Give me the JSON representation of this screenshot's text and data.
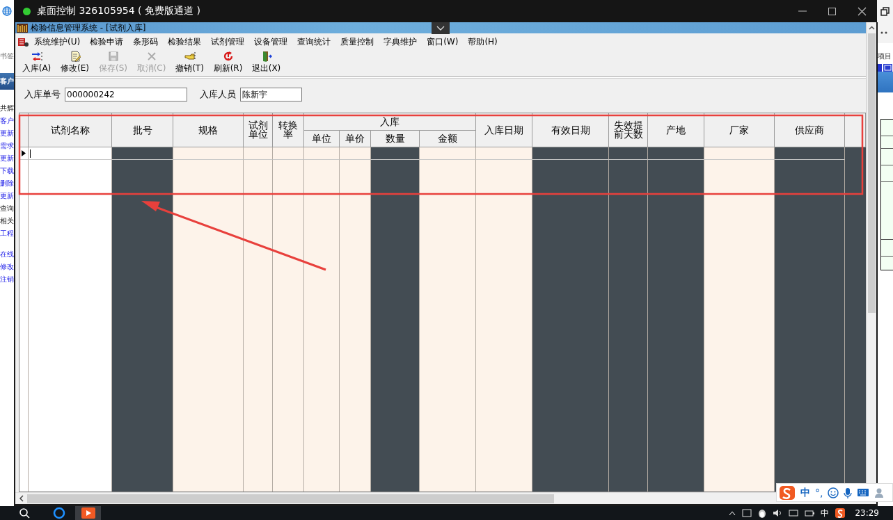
{
  "remote_window": {
    "title": "桌面控制 326105954 ( 免费版通道 )"
  },
  "background_left": {
    "bookmarks": "书签",
    "header": "客户",
    "links": [
      {
        "text": "共辉",
        "link": false
      },
      {
        "text": "客户",
        "link": true
      },
      {
        "text": "更新",
        "link": true
      },
      {
        "text": "需求",
        "link": true
      },
      {
        "text": "更新",
        "link": true
      },
      {
        "text": "下载",
        "link": true
      },
      {
        "text": "删除",
        "link": true
      },
      {
        "text": "更新",
        "link": true
      },
      {
        "text": "查询",
        "link": false
      },
      {
        "text": "相关",
        "link": false
      },
      {
        "text": "工程",
        "link": true
      },
      {
        "text": "在线",
        "link": true
      },
      {
        "text": "修改",
        "link": true
      },
      {
        "text": "注销",
        "link": true
      }
    ]
  },
  "background_right": {
    "label": "项目"
  },
  "app": {
    "title": "检验信息管理系统 - [试剂入库]",
    "menu": [
      "系统维护(U)",
      "检验申请",
      "条形码",
      "检验结果",
      "试剂管理",
      "设备管理",
      "查询统计",
      "质量控制",
      "字典维护",
      "窗口(W)",
      "帮助(H)"
    ],
    "toolbar": [
      {
        "label": "入库(A)",
        "kind": "add",
        "disabled": false
      },
      {
        "label": "修改(E)",
        "kind": "edit",
        "disabled": false
      },
      {
        "label": "保存(S)",
        "kind": "save",
        "disabled": true
      },
      {
        "label": "取消(C)",
        "kind": "cancel",
        "disabled": true
      },
      {
        "label": "撤销(T)",
        "kind": "undo",
        "disabled": false
      },
      {
        "label": "刷新(R)",
        "kind": "refresh",
        "disabled": false
      },
      {
        "label": "退出(X)",
        "kind": "exit",
        "disabled": false
      }
    ],
    "form": [
      {
        "label": "入库单号",
        "value": "000000242"
      },
      {
        "label": "入库人员",
        "value": "陈新宇"
      }
    ],
    "grid": {
      "columns": [
        {
          "label": "试剂名称",
          "color": "#ffffff"
        },
        {
          "label": "批号",
          "color": "#434c53"
        },
        {
          "label": "规格",
          "color": "#fdf3ea"
        },
        {
          "label": "试剂单位",
          "color": "#fdf3ea"
        },
        {
          "label": "转换率",
          "color": "#fdf3ea"
        },
        {
          "label": "入库",
          "children": [
            {
              "label": "单位",
              "color": "#fdf3ea"
            },
            {
              "label": "单价",
              "color": "#fdf3ea"
            },
            {
              "label": "数量",
              "color": "#434c53"
            },
            {
              "label": "金额",
              "color": "#fdf3ea"
            }
          ]
        },
        {
          "label": "入库日期",
          "color": "#fdf3ea"
        },
        {
          "label": "有效日期",
          "color": "#434c53"
        },
        {
          "label": "失效提前天数",
          "color": "#434c53"
        },
        {
          "label": "产地",
          "color": "#434c53"
        },
        {
          "label": "厂家",
          "color": "#fdf3ea"
        },
        {
          "label": "供应商",
          "color": "#434c53"
        }
      ],
      "rows": [
        {
          "selected": true
        }
      ]
    }
  },
  "ime_bar": {
    "mode": "中",
    "punctuation": "°,"
  },
  "taskbar": {
    "tray_ime": "中",
    "time": "23:29"
  },
  "annotations": {
    "highlight_frame": true,
    "arrow": true
  }
}
